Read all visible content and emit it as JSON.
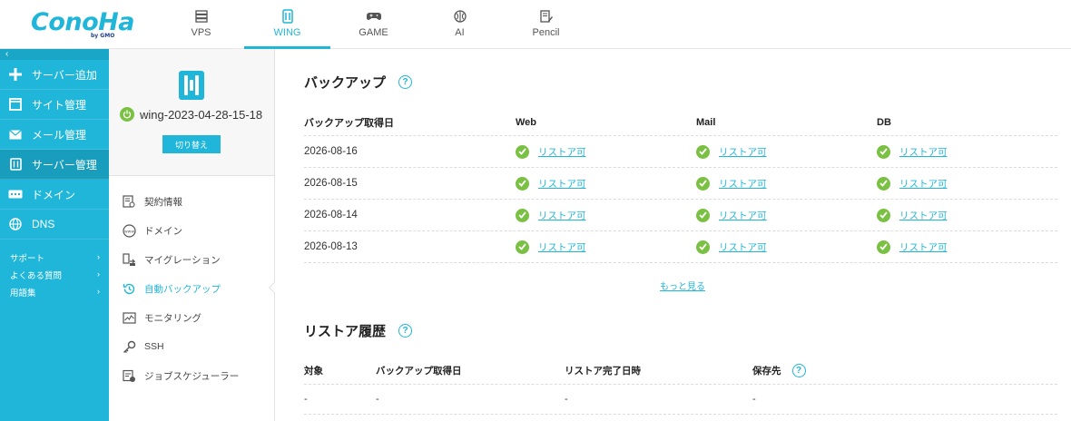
{
  "brand": {
    "logo_text": "ConoHa",
    "logo_sub": "by GMO"
  },
  "service_tabs": [
    {
      "label": "VPS",
      "icon": "server-stack-icon",
      "active": false
    },
    {
      "label": "WING",
      "icon": "wing-server-icon",
      "active": true
    },
    {
      "label": "GAME",
      "icon": "gamepad-icon",
      "active": false
    },
    {
      "label": "AI",
      "icon": "brain-icon",
      "active": false
    },
    {
      "label": "Pencil",
      "icon": "pencil-doc-icon",
      "active": false
    }
  ],
  "leftnav": {
    "collapse": "‹",
    "items": [
      {
        "label": "サーバー追加",
        "icon": "plus-icon"
      },
      {
        "label": "サイト管理",
        "icon": "window-icon"
      },
      {
        "label": "メール管理",
        "icon": "mail-icon"
      },
      {
        "label": "サーバー管理",
        "icon": "server-icon"
      },
      {
        "label": "ドメイン",
        "icon": "domain-icon"
      },
      {
        "label": "DNS",
        "icon": "globe-icon"
      }
    ],
    "sub_items": [
      {
        "label": "サポート",
        "icon": "chevron-right-icon"
      },
      {
        "label": "よくある質問",
        "icon": "chevron-right-icon"
      },
      {
        "label": "用語集",
        "icon": "chevron-right-icon"
      }
    ]
  },
  "server_panel": {
    "name": "wing-2023-04-28-15-18",
    "switch_label": "切り替え",
    "menu": [
      {
        "label": "契約情報",
        "icon": "contract-icon"
      },
      {
        "label": "ドメイン",
        "icon": "www-icon"
      },
      {
        "label": "マイグレーション",
        "icon": "migration-icon"
      },
      {
        "label": "自動バックアップ",
        "icon": "backup-clock-icon"
      },
      {
        "label": "モニタリング",
        "icon": "monitor-icon"
      },
      {
        "label": "SSH",
        "icon": "key-icon"
      },
      {
        "label": "ジョブスケジューラー",
        "icon": "scheduler-icon"
      }
    ]
  },
  "backup": {
    "title": "バックアップ",
    "help": "?",
    "headers": [
      "バックアップ取得日",
      "Web",
      "Mail",
      "DB"
    ],
    "rows": [
      {
        "date": "2026-08-16",
        "web": "リストア可",
        "mail": "リストア可",
        "db": "リストア可"
      },
      {
        "date": "2026-08-15",
        "web": "リストア可",
        "mail": "リストア可",
        "db": "リストア可"
      },
      {
        "date": "2026-08-14",
        "web": "リストア可",
        "mail": "リストア可",
        "db": "リストア可"
      },
      {
        "date": "2026-08-13",
        "web": "リストア可",
        "mail": "リストア可",
        "db": "リストア可"
      }
    ],
    "more": "もっと見る"
  },
  "restore_history": {
    "title": "リストア履歴",
    "help": "?",
    "headers": [
      "対象",
      "バックアップ取得日",
      "リストア完了日時",
      "保存先"
    ],
    "rows": [
      {
        "target": "-",
        "backup_date": "-",
        "completed": "-",
        "destination": "-"
      }
    ]
  },
  "colors": {
    "accent": "#1fb6d9",
    "ok": "#7ac143",
    "nav_active": "#189dbd"
  }
}
